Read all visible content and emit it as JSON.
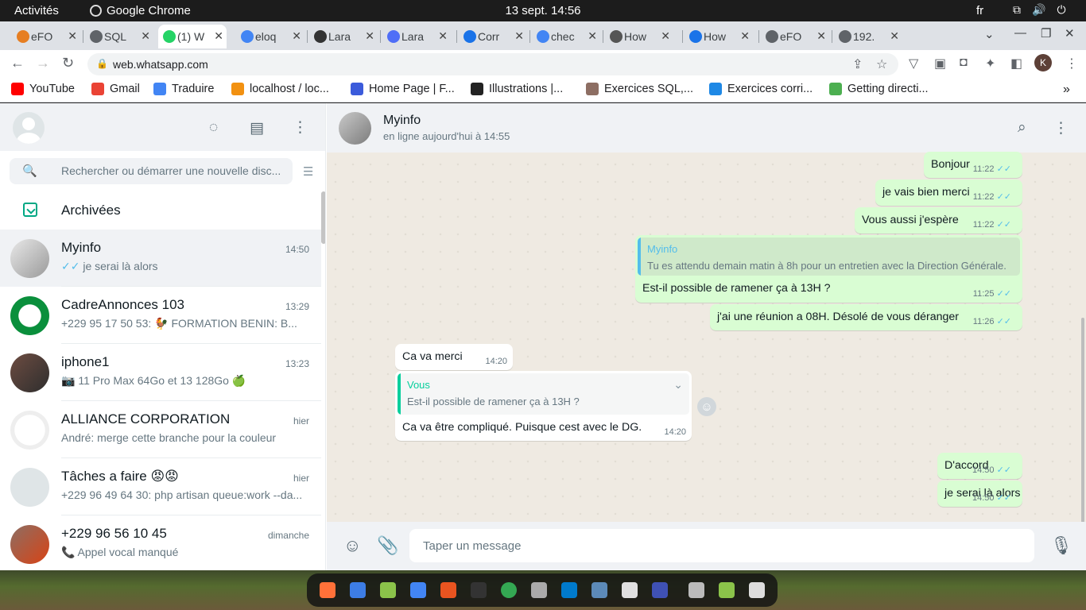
{
  "system": {
    "activities": "Activités",
    "app_name": "Google Chrome",
    "datetime": "13 sept.  14:56",
    "lang": "fr"
  },
  "tabs": [
    {
      "title": "eFO",
      "icon_color": "#e67e22"
    },
    {
      "title": "SQL",
      "icon_color": "#5f6368"
    },
    {
      "title": "(1) W",
      "icon_color": "#25d366",
      "active": true
    },
    {
      "title": "eloq",
      "icon_color": "#4285f4"
    },
    {
      "title": "Lara",
      "icon_color": "#333333"
    },
    {
      "title": "Lara",
      "icon_color": "#4f6ef7"
    },
    {
      "title": "Corr",
      "icon_color": "#1a73e8"
    },
    {
      "title": "chec",
      "icon_color": "#4285f4"
    },
    {
      "title": "How",
      "icon_color": "#555555"
    },
    {
      "title": "How",
      "icon_color": "#1a73e8"
    },
    {
      "title": "eFO",
      "icon_color": "#5f6368"
    },
    {
      "title": "192.",
      "icon_color": "#5f6368"
    }
  ],
  "address": {
    "url": "web.whatsapp.com",
    "profile_initial": "K"
  },
  "bookmarks": [
    {
      "label": "YouTube",
      "color": "#ff0000"
    },
    {
      "label": "Gmail",
      "color": "#ea4335"
    },
    {
      "label": "Traduire",
      "color": "#4285f4"
    },
    {
      "label": "localhost / loc...",
      "color": "#f29111"
    },
    {
      "label": "Home Page | F...",
      "color": "#3b5bdb"
    },
    {
      "label": "Illustrations |...",
      "color": "#222222"
    },
    {
      "label": "Exercices SQL,...",
      "color": "#8d6e63"
    },
    {
      "label": "Exercices corri...",
      "color": "#1e88e5"
    },
    {
      "label": "Getting directi...",
      "color": "#4caf50"
    }
  ],
  "left": {
    "search_placeholder": "Rechercher ou démarrer une nouvelle disc...",
    "archived_label": "Archivées",
    "chats": [
      {
        "name": "Myinfo",
        "time": "14:50",
        "preview": "je serai là alors",
        "ticks": "✓✓",
        "selected": true
      },
      {
        "name": "CadreAnnonces 103",
        "time": "13:29",
        "preview": "+229 95 17 50 53: 🐓 FORMATION BENIN: B..."
      },
      {
        "name": "iphone1",
        "time": "13:23",
        "preview": "📷 11 Pro Max 64Go et 13 128Go 🍏"
      },
      {
        "name": "ALLIANCE CORPORATION",
        "time": "hier",
        "preview": "André: merge cette branche pour la couleur"
      },
      {
        "name": "Tâches a faire 😡😡",
        "time": "hier",
        "preview": "+229 96 49 64 30: php artisan queue:work --da..."
      },
      {
        "name": "+229 96 56 10 45",
        "time": "dimanche",
        "preview": "📞 Appel vocal manqué"
      }
    ]
  },
  "conversation": {
    "contact_name": "Myinfo",
    "status": "en ligne aujourd'hui à 14:55",
    "input_placeholder": "Taper un message",
    "ticks": "✓✓",
    "messages": [
      {
        "dir": "out",
        "text": "Bonjour",
        "time": "11:22"
      },
      {
        "dir": "out",
        "text": "je vais bien merci",
        "time": "11:22"
      },
      {
        "dir": "out",
        "text": "Vous aussi j'espère",
        "time": "11:22"
      },
      {
        "dir": "out",
        "quote_name": "Myinfo",
        "quote_text": "Tu es attendu demain matin à 8h pour un entretien avec la Direction Générale.",
        "text": "Est-il possible de ramener ça à 13H ?",
        "time": "11:25"
      },
      {
        "dir": "out",
        "text": "j'ai une réunion a 08H. Désolé de vous déranger",
        "time": "11:26"
      },
      {
        "dir": "in",
        "text": "Ca va merci",
        "time": "14:20"
      },
      {
        "dir": "in",
        "quote_name": "Vous",
        "quote_text": "Est-il possible de ramener ça à 13H ?",
        "text": "Ca va être compliqué. Puisque cest avec le DG.",
        "time": "14:20"
      },
      {
        "dir": "out",
        "text": "D'accord",
        "time": "14:50"
      },
      {
        "dir": "out",
        "text": "je serai là alors",
        "time": "14:50"
      }
    ]
  },
  "colors": {
    "accent": "#00a884",
    "out_bubble": "#d9fdd3",
    "in_bubble": "#ffffff",
    "tick_read": "#53bdeb"
  }
}
